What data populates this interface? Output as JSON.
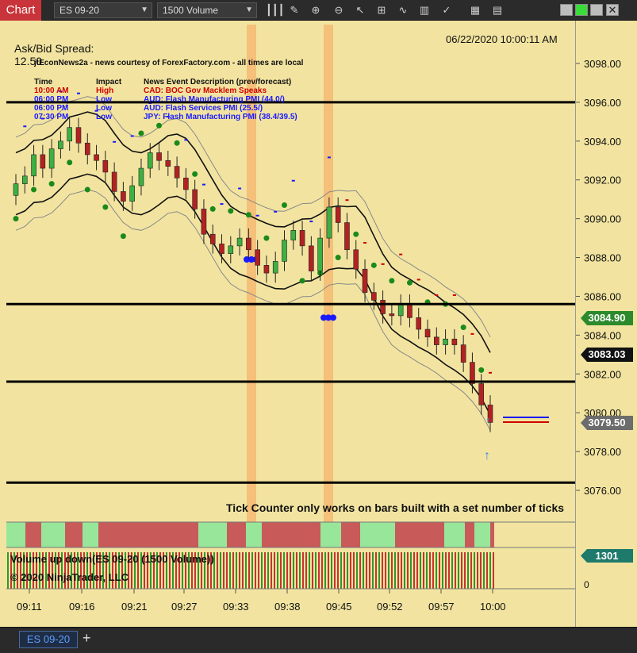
{
  "toolbar": {
    "chart_label": "Chart",
    "instrument": "ES 09-20",
    "interval": "1500 Volume",
    "icons": [
      "bar-type-icon",
      "drawing-tools-icon",
      "zoom-in-icon",
      "zoom-out-icon",
      "pointer-icon",
      "crosshair-icon",
      "indicators-icon",
      "strategies-icon",
      "chart-style-icon",
      "properties-icon",
      "data-box-icon"
    ]
  },
  "chart": {
    "timestamp": "06/22/2020 10:00:11 AM",
    "ask_bid_label": "Ask/Bid Spread:",
    "ask_bid_value": "12.50",
    "f_button": "F",
    "news_header": "jtEconNews2a - news courtesy of ForexFactory.com - all times are local",
    "news_columns": [
      "Time",
      "Impact",
      "News Event Description (prev/forecast)"
    ],
    "news_rows": [
      {
        "time": "10:00 AM",
        "impact": "High",
        "desc": "CAD: BOC Gov Macklem Speaks",
        "color": "#d00000"
      },
      {
        "time": "06:00 PM",
        "impact": "Low",
        "desc": "AUD: Flash Manufacturing PMI (44.0/)",
        "color": "#1a1aff"
      },
      {
        "time": "06:00 PM",
        "impact": "Low",
        "desc": "AUD: Flash Services PMI (25.5/)",
        "color": "#1a1aff"
      },
      {
        "time": "07:30 PM",
        "impact": "Low",
        "desc": "JPY: Flash Manufacturing PMI (38.4/39.5)",
        "color": "#1a1aff"
      }
    ],
    "tick_counter_msg": "Tick Counter only works on bars built with a set number of ticks",
    "volume_label": "Volume up down(ES 09-20 (1500 Volume))",
    "copyright": "© 2020 NinjaTrader, LLC",
    "price_tag_green": "3084.90",
    "price_tag_black": "3083.03",
    "price_tag_last": "3079.50",
    "volume_tag": "1301",
    "volume_zero": "0"
  },
  "chart_data": {
    "type": "candlestick",
    "y_ticks": [
      "3098.00",
      "3096.00",
      "3094.00",
      "3092.00",
      "3090.00",
      "3088.00",
      "3086.00",
      "3084.00",
      "3082.00",
      "3080.00",
      "3078.00",
      "3076.00"
    ],
    "ylim": [
      3075.0,
      3099.5
    ],
    "x_ticks": [
      "09:11",
      "09:16",
      "09:21",
      "09:27",
      "09:33",
      "09:38",
      "09:45",
      "09:52",
      "09:57",
      "10:00"
    ],
    "horizontal_lines": [
      3096.0,
      3085.6,
      3081.6,
      3076.4
    ],
    "closes": [
      3091.8,
      3092.2,
      3093.3,
      3092.6,
      3093.6,
      3094.0,
      3094.7,
      3093.9,
      3093.3,
      3093.0,
      3092.4,
      3091.4,
      3090.9,
      3091.7,
      3092.6,
      3093.4,
      3093.0,
      3092.7,
      3092.1,
      3091.5,
      3090.5,
      3089.2,
      3088.7,
      3088.2,
      3088.6,
      3089.0,
      3088.4,
      3087.6,
      3087.2,
      3087.8,
      3088.9,
      3089.4,
      3088.6,
      3087.3,
      3089.0,
      3090.6,
      3089.8,
      3088.4,
      3087.4,
      3086.2,
      3085.8,
      3085.1,
      3085.0,
      3085.6,
      3084.9,
      3084.3,
      3083.9,
      3083.5,
      3083.8,
      3083.5,
      3082.6,
      3081.5,
      3080.4,
      3079.5
    ],
    "volume_labels": [
      "1301",
      "0"
    ]
  }
}
